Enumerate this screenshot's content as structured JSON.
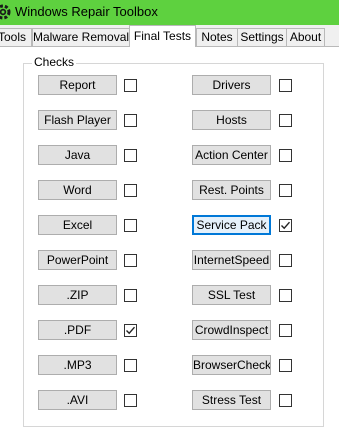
{
  "window": {
    "title": "Windows Repair Toolbox",
    "accent": "#5ed13f"
  },
  "tabs": [
    {
      "label": "Tools",
      "active": false
    },
    {
      "label": "Malware Removal",
      "active": false
    },
    {
      "label": "Final Tests",
      "active": true
    },
    {
      "label": "Notes",
      "active": false
    },
    {
      "label": "Settings",
      "active": false
    },
    {
      "label": "About",
      "active": false
    }
  ],
  "checks": {
    "group_label": "Checks",
    "left": [
      {
        "label": "Report",
        "checked": false
      },
      {
        "label": "Flash Player",
        "checked": false
      },
      {
        "label": "Java",
        "checked": false
      },
      {
        "label": "Word",
        "checked": false
      },
      {
        "label": "Excel",
        "checked": false
      },
      {
        "label": "PowerPoint",
        "checked": false
      },
      {
        "label": ".ZIP",
        "checked": false
      },
      {
        "label": ".PDF",
        "checked": true
      },
      {
        "label": ".MP3",
        "checked": false
      },
      {
        "label": ".AVI",
        "checked": false
      }
    ],
    "right": [
      {
        "label": "Drivers",
        "checked": false
      },
      {
        "label": "Hosts",
        "checked": false
      },
      {
        "label": "Action Center",
        "checked": false
      },
      {
        "label": "Rest. Points",
        "checked": false
      },
      {
        "label": "Service Pack",
        "checked": true,
        "focused": true
      },
      {
        "label": "InternetSpeed",
        "checked": false
      },
      {
        "label": "SSL Test",
        "checked": false
      },
      {
        "label": "CrowdInspect",
        "checked": false
      },
      {
        "label": "BrowserCheck",
        "checked": false
      },
      {
        "label": "Stress Test",
        "checked": false
      }
    ]
  }
}
